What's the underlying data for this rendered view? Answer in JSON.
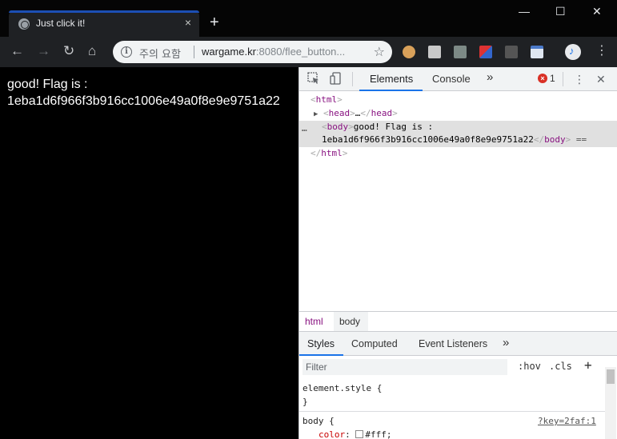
{
  "tab": {
    "title": "Just click it!",
    "close": "×",
    "new_tab": "+"
  },
  "window_controls": {
    "minimize": "—",
    "maximize": "☐",
    "close": "✕"
  },
  "toolbar": {
    "back": "←",
    "forward": "→",
    "reload": "↻",
    "home": "⌂",
    "security_label": "주의 요함",
    "url_host": "wargame.kr",
    "url_rest": ":8080/flee_button...",
    "star": "☆",
    "menu": "⋮"
  },
  "page": {
    "line1": "good! Flag is :",
    "line2": "1eba1d6f966f3b916cc1006e49a0f8e9e9751a22"
  },
  "devtools": {
    "tabs": [
      "Elements",
      "Console"
    ],
    "more_tabs": "»",
    "error_count": "1",
    "menu": "⋮",
    "close": "✕",
    "dom": {
      "html_open": "html",
      "head": "head",
      "head_ellipsis": "…",
      "body_tag": "body",
      "body_text_1": "good! Flag is :",
      "body_text_2": "1eba1d6f966f3b916cc1006e49a0f8e9e9751a22",
      "body_suffix": "==",
      "html_close": "html",
      "row_ellipsis": "…"
    },
    "breadcrumb": [
      "html",
      "body"
    ],
    "sub_tabs": [
      "Styles",
      "Computed",
      "Event Listeners"
    ],
    "sub_more": "»",
    "filter_placeholder": "Filter",
    "hov": ":hov",
    "cls": ".cls",
    "add": "+",
    "styles": {
      "element_style": "element.style {",
      "element_close": "}",
      "body_selector": "body {",
      "body_source": "?key=2faf:1",
      "color_prop": "color",
      "color_value": "#fff;"
    }
  }
}
